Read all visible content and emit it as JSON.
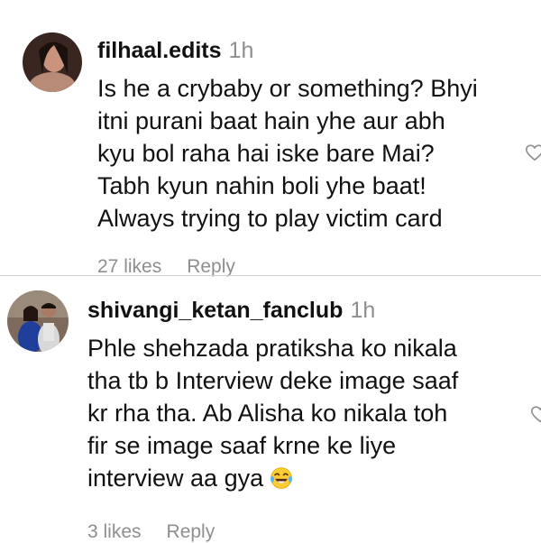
{
  "comments": [
    {
      "username": "filhaal.edits",
      "time": "1h",
      "lines": [
        "Is he a crybaby or something? Bhyi",
        "itni purani baat hain yhe aur abh",
        "kyu bol raha hai iske bare Mai?",
        "Tabh kyun nahin boli yhe baat!",
        "Always trying to play victim card"
      ],
      "likes": "27 likes",
      "reply": "Reply"
    },
    {
      "username": "shivangi_ketan_fanclub",
      "time": "1h",
      "lines": [
        "Phle shehzada pratiksha ko nikala",
        "tha tb b Interview deke image saaf",
        "kr rha tha. Ab Alisha ko nikala toh",
        "fir se image saaf krne ke liye",
        "interview aa gya"
      ],
      "emoji": "face-with-tears-of-joy-icon",
      "likes": "3 likes",
      "reply": "Reply"
    }
  ]
}
